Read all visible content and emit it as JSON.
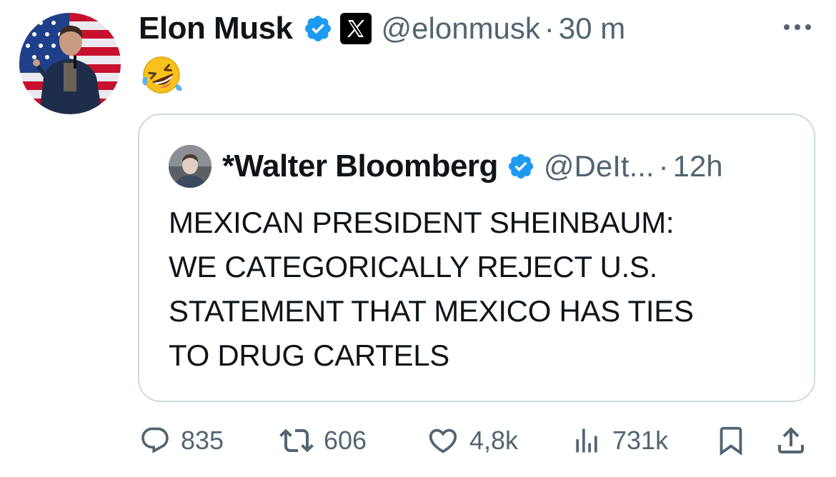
{
  "tweet": {
    "author_name": "Elon Musk",
    "handle": "@elonmusk",
    "separator": "·",
    "time": "30 m",
    "emoji": "🤣"
  },
  "quoted_tweet": {
    "author_name": "*Walter Bloomberg",
    "handle": "@DeIt...",
    "separator": "·",
    "time": "12h",
    "text_lines": [
      "MEXICAN PRESIDENT SHEINBAUM:",
      "WE CATEGORICALLY REJECT U.S.",
      "STATEMENT THAT MEXICO HAS TIES",
      "TO DRUG CARTELS"
    ]
  },
  "actions": {
    "replies": "835",
    "reposts": "606",
    "likes": "4,8k",
    "views": "731k"
  },
  "icons": {
    "verified": "verified-badge-icon",
    "affiliate": "x-logo-icon",
    "more": "more-options-icon",
    "reply": "reply-icon",
    "repost": "repost-icon",
    "like": "heart-icon",
    "views": "views-chart-icon",
    "bookmark": "bookmark-icon",
    "share": "share-icon"
  },
  "colors": {
    "verified_blue": "#1d9bf0",
    "secondary_text": "#536471",
    "border": "#cfd9de"
  }
}
